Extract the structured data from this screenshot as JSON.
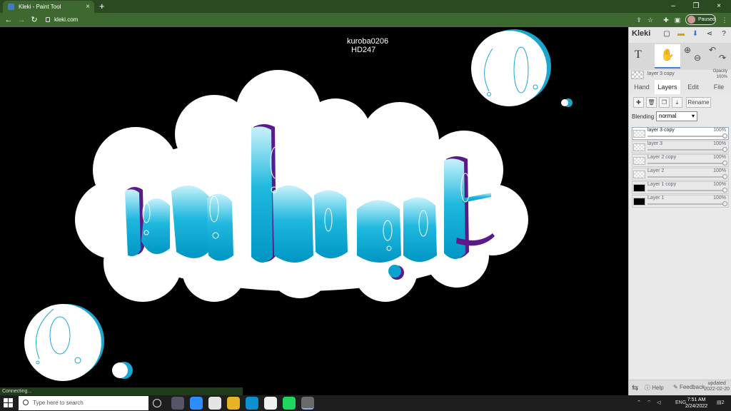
{
  "browser": {
    "tab_title": "Kleki - Paint Tool",
    "tab_close": "×",
    "new_tab": "+",
    "url": "kleki.com",
    "profile_status": "Paused",
    "window_controls": {
      "minimize": "–",
      "restore": "❐",
      "close": "×"
    }
  },
  "canvas": {
    "credit_line1": "kuroba0206",
    "credit_line2": "HD247"
  },
  "panel": {
    "logo": "Kleki",
    "active_layer": "layer 3 copy",
    "opacity_label": "Opacity",
    "opacity_value": "100%",
    "tabs": [
      {
        "label": "Hand"
      },
      {
        "label": "Layers"
      },
      {
        "label": "Edit"
      },
      {
        "label": "File"
      }
    ],
    "rename_label": "Rename",
    "blending_label": "Blending",
    "blending_value": "normal",
    "layers": [
      {
        "name": "layer 3 copy",
        "opacity": "100%"
      },
      {
        "name": "layer 3",
        "opacity": "100%"
      },
      {
        "name": "Layer 2 copy",
        "opacity": "100%"
      },
      {
        "name": "Layer 2",
        "opacity": "100%"
      },
      {
        "name": "Layer 1 copy",
        "opacity": "100%"
      },
      {
        "name": "Layer 1",
        "opacity": "100%"
      }
    ],
    "help": "Help",
    "feedback": "Feedback",
    "updated_label": "updated",
    "updated_date": "2022-02-20"
  },
  "status_text": "Connecting...",
  "taskbar": {
    "search_placeholder": "Type here to search",
    "lang": "ENG",
    "time": "7:51 AM",
    "date": "2/24/2022",
    "notifications": "2"
  },
  "colors": {
    "artwork_cyan": "#00a8d6",
    "artwork_light_cyan": "#aeeaf8",
    "artwork_purple": "#5a1a8a",
    "browser_green": "#3d6830"
  }
}
